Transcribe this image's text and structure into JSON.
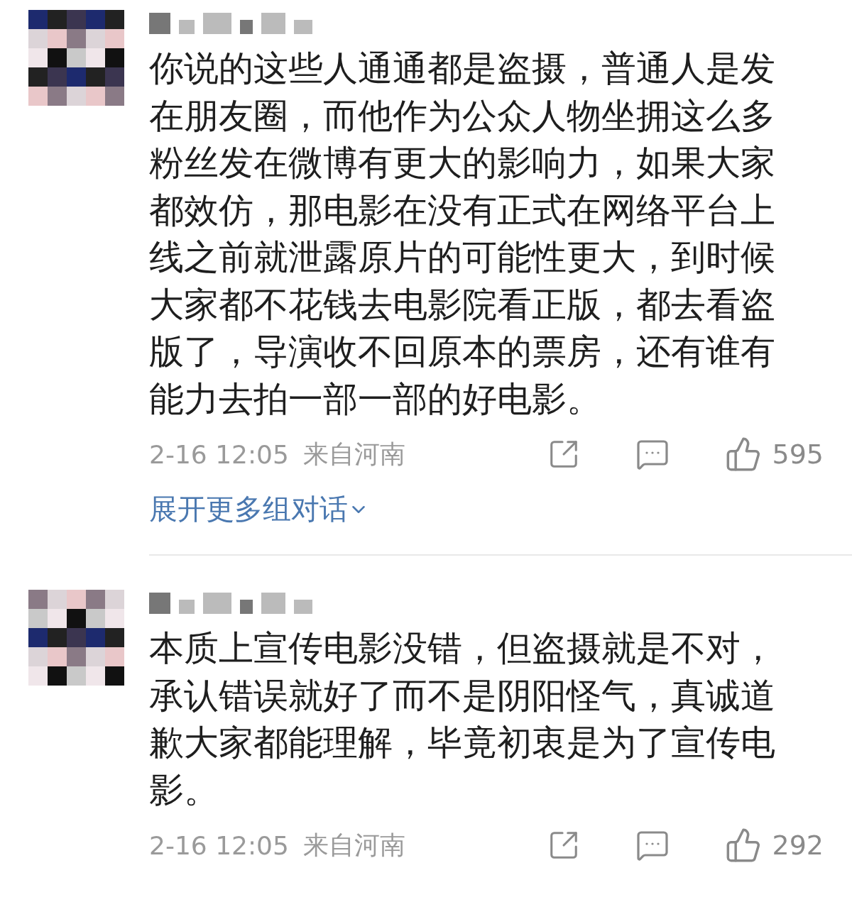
{
  "comments": [
    {
      "text": "你说的这些人通通都是盗摄，普通人是发在朋友圈，而他作为公众人物坐拥这么多粉丝发在微博有更大的影响力，如果大家都效仿，那电影在没有正式在网络平台上线之前就泄露原片的可能性更大，到时候大家都不花钱去电影院看正版，都去看盗版了，导演收不回原本的票房，还有谁有能力去拍一部一部的好电影。",
      "time": "2-16 12:05",
      "location": "来自河南",
      "likes": "595",
      "expand_link": "展开更多组对话"
    },
    {
      "text": "本质上宣传电影没错，但盗摄就是不对，承认错误就好了而不是阴阳怪气，真诚道歉大家都能理解，毕竟初衷是为了宣传电影。",
      "time": "2-16 12:05",
      "location": "来自河南",
      "likes": "292"
    }
  ]
}
